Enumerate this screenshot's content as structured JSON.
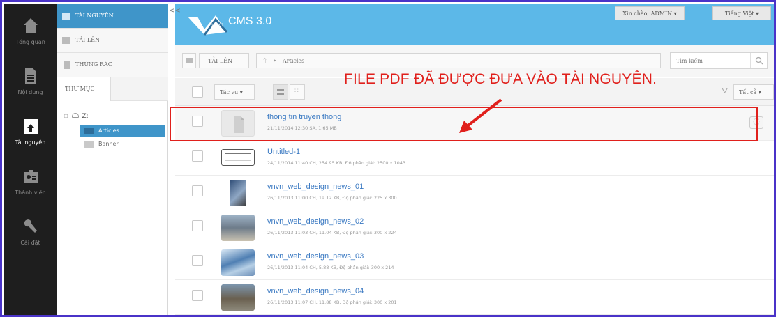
{
  "nav": {
    "items": [
      {
        "label": "Tổng quan",
        "icon": "home-icon"
      },
      {
        "label": "Nội dung",
        "icon": "document-icon"
      },
      {
        "label": "Tài nguyên",
        "icon": "resource-box-icon",
        "active": true
      },
      {
        "label": "Thành viên",
        "icon": "member-card-icon"
      },
      {
        "label": "Cài đặt",
        "icon": "wrench-icon"
      }
    ]
  },
  "panel": {
    "resources": "TÀI NGUYÊN",
    "upload": "TẢI LÊN",
    "trash": "THÙNG RÁC",
    "folder_tab": "THƯ MỤC",
    "tree_root": "Z:",
    "tree_items": [
      "Articles",
      "Banner"
    ]
  },
  "collapse_label": "<<",
  "header": {
    "logo_small": "vnvn",
    "logo_main": "CMS 3.0",
    "greeting": "Xin chào, ADMIN  ▾",
    "language": "Tiếng Việt  ▾"
  },
  "toolbar": {
    "upload": "TẢI LÊN",
    "breadcrumb_sep": "▸",
    "breadcrumb": "Articles",
    "search_placeholder": "Tìm kiếm",
    "actions": "Tác vụ  ▾",
    "filter_all": "Tất cả  ▾"
  },
  "annotation": "FILE PDF ĐÃ ĐƯỢC ĐƯA VÀO TÀI NGUYÊN.",
  "files": [
    {
      "name": "thong tin truyen thong",
      "meta": "21/11/2014 12:30 SA, 1.65 MB"
    },
    {
      "name": "Untitled-1",
      "meta": "24/11/2014 11:40 CH, 254.95 KB, Độ phân giải: 2500 x 1043"
    },
    {
      "name": "vnvn_web_design_news_01",
      "meta": "26/11/2013 11:00 CH, 19.12 KB, Độ phân giải: 225 x 300"
    },
    {
      "name": "vnvn_web_design_news_02",
      "meta": "26/11/2013 11:03 CH, 11.04 KB, Độ phân giải: 300 x 224"
    },
    {
      "name": "vnvn_web_design_news_03",
      "meta": "26/11/2013 11:04 CH, 5.88 KB, Độ phân giải: 300 x 214"
    },
    {
      "name": "vnvn_web_design_news_04",
      "meta": "26/11/2013 11:07 CH, 11.88 KB, Độ phân giải: 300 x 201"
    }
  ],
  "colors": {
    "accent": "#3f95c9",
    "header": "#5cb8e8",
    "annotation": "#e0201c"
  }
}
